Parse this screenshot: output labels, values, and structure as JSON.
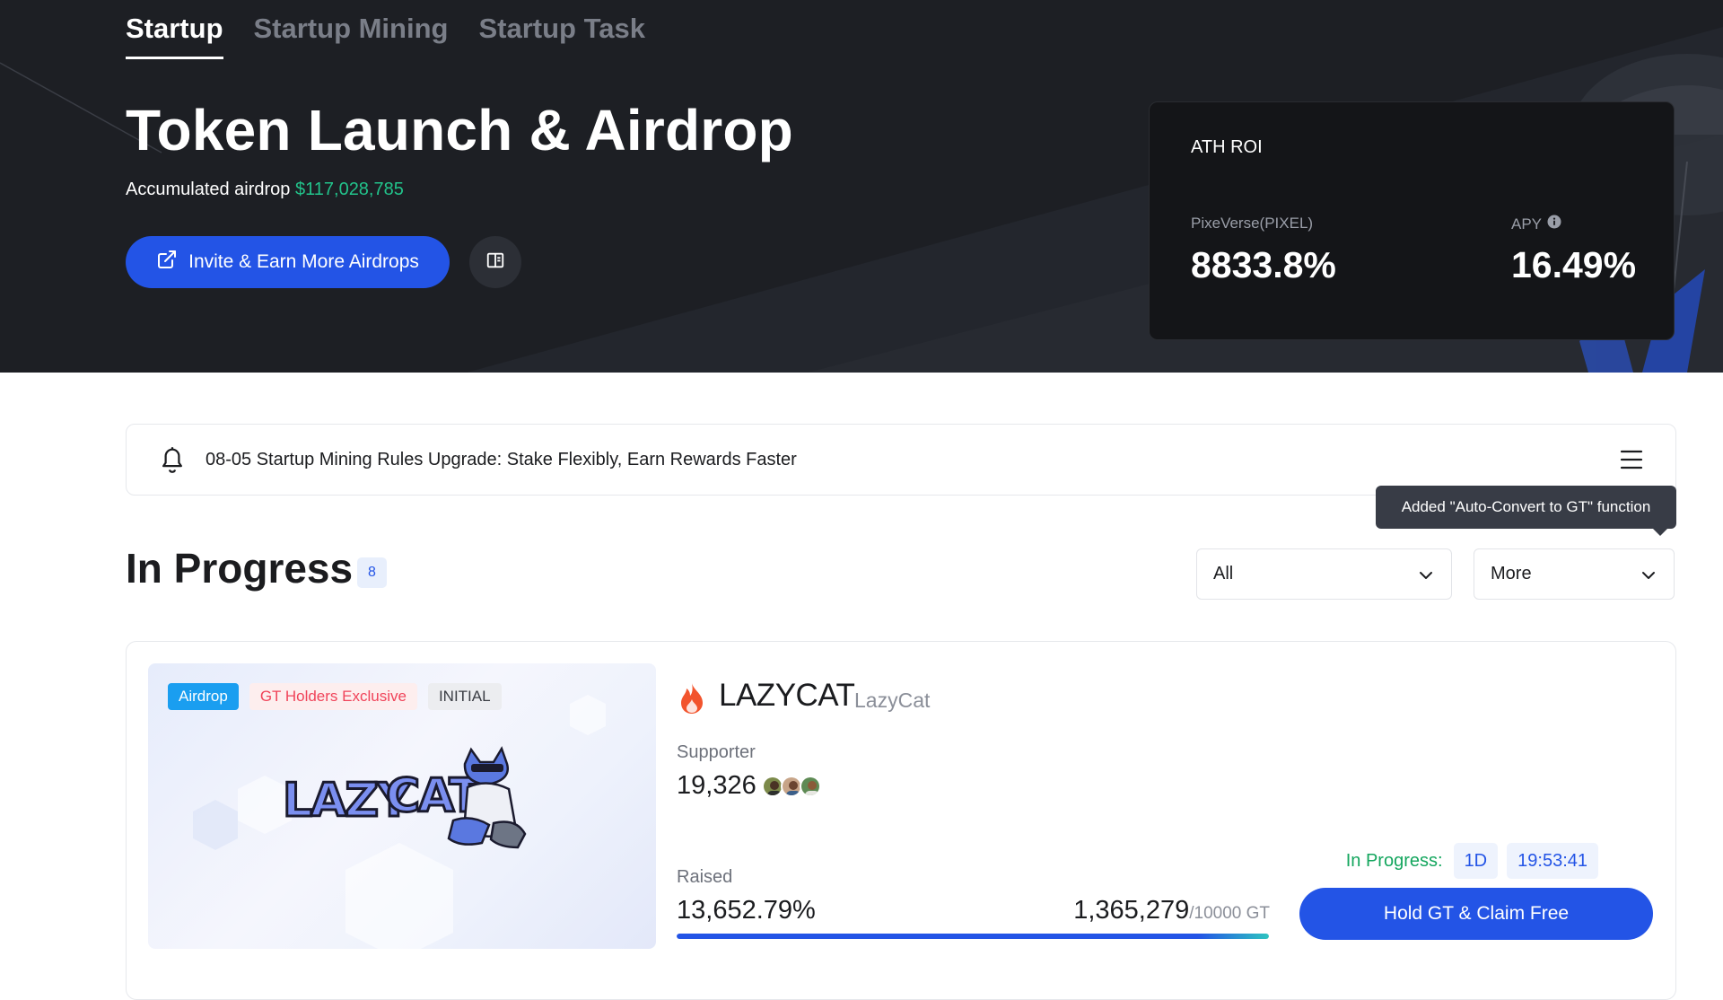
{
  "nav": {
    "tabs": [
      {
        "label": "Startup",
        "active": true
      },
      {
        "label": "Startup Mining",
        "active": false
      },
      {
        "label": "Startup Task",
        "active": false
      }
    ]
  },
  "hero": {
    "title": "Token Launch & Airdrop",
    "accumulated_label": "Accumulated airdrop",
    "accumulated_value": "$117,028,785",
    "invite_label": "Invite & Earn More Airdrops",
    "invite_icon": "external-link-icon",
    "book_icon": "book-icon"
  },
  "ath": {
    "title": "ATH ROI",
    "project_label": "PixeVerse(PIXEL)",
    "project_value": "8833.8%",
    "apy_label": "APY",
    "apy_value": "16.49%"
  },
  "notice": {
    "icon": "bell-icon",
    "text": "08-05 Startup Mining Rules Upgrade: Stake Flexibly, Earn Rewards Faster",
    "menu_icon": "menu-icon",
    "tooltip": "Added \"Auto-Convert to GT\" function"
  },
  "section": {
    "title": "In Progress",
    "count": "8",
    "filter1": "All",
    "filter2": "More"
  },
  "project": {
    "tags": [
      "Airdrop",
      "GT Holders Exclusive",
      "INITIAL"
    ],
    "name": "LAZYCAT",
    "subname": "LazyCat",
    "supporter_label": "Supporter",
    "supporter_value": "19,326",
    "raised_label": "Raised",
    "raised_pct": "13,652.79%",
    "raised_amount": "1,365,279",
    "raised_total": "/10000 GT",
    "progress": 1.0,
    "status_label": "In Progress:",
    "days": "1D",
    "time": "19:53:41",
    "cta": "Hold GT & Claim Free",
    "logo_text": "LAZYCAT"
  },
  "colors": {
    "accent": "#2354e6",
    "positive": "#22c38b",
    "status_green": "#14a65e",
    "hero_bg": "#1d1f24"
  }
}
